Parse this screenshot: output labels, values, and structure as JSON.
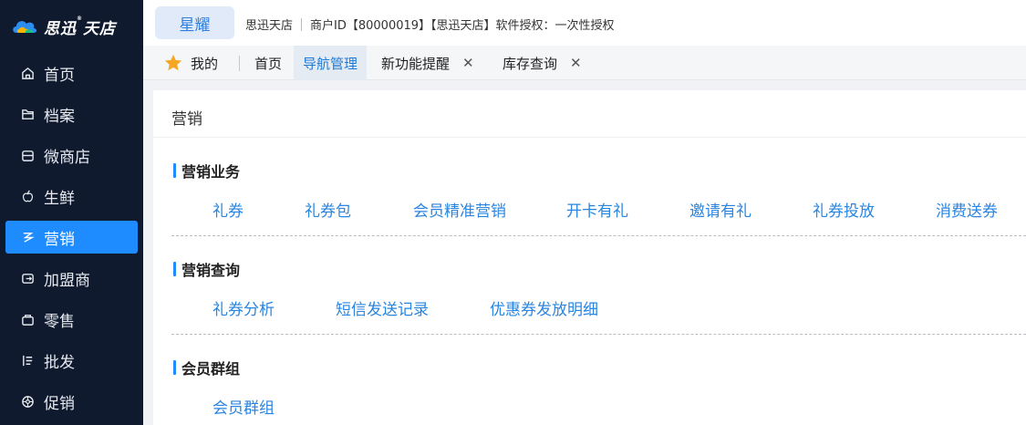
{
  "app": {
    "logo_text": "思迅",
    "logo_text2": "天店",
    "logo_mark": "®"
  },
  "sidebar": {
    "items": [
      {
        "label": "首页",
        "icon": "home-icon"
      },
      {
        "label": "档案",
        "icon": "folder-icon"
      },
      {
        "label": "微商店",
        "icon": "store-icon"
      },
      {
        "label": "生鲜",
        "icon": "apple-icon"
      },
      {
        "label": "营销",
        "icon": "marketing-icon",
        "active": true
      },
      {
        "label": "加盟商",
        "icon": "franchise-icon"
      },
      {
        "label": "零售",
        "icon": "bag-icon"
      },
      {
        "label": "批发",
        "icon": "list-icon"
      },
      {
        "label": "促销",
        "icon": "promo-icon"
      }
    ]
  },
  "topbar": {
    "brand_tab": "星耀",
    "shop_name": "思迅天店",
    "merchant_info": "商户ID【80000019】【思迅天店】软件授权：一次性授权"
  },
  "tabs": {
    "favorites_label": "我的",
    "items": [
      {
        "label": "首页",
        "closable": false
      },
      {
        "label": "导航管理",
        "closable": false,
        "active": true
      },
      {
        "label": "新功能提醒",
        "closable": true
      },
      {
        "label": "库存查询",
        "closable": true
      }
    ],
    "close_glyph": "✕"
  },
  "panel": {
    "title": "营销",
    "sections": [
      {
        "title": "营销业务",
        "links": [
          "礼券",
          "礼券包",
          "会员精准营销",
          "开卡有礼",
          "邀请有礼",
          "礼券投放",
          "消费送券"
        ]
      },
      {
        "title": "营销查询",
        "links": [
          "礼券分析",
          "短信发送记录",
          "优惠券发放明细"
        ]
      },
      {
        "title": "会员群组",
        "links": [
          "会员群组"
        ]
      }
    ]
  },
  "colors": {
    "sidebar_bg": "#0f1a2e",
    "accent": "#1e8bff",
    "link": "#2a85e0",
    "star": "#f5a623"
  }
}
